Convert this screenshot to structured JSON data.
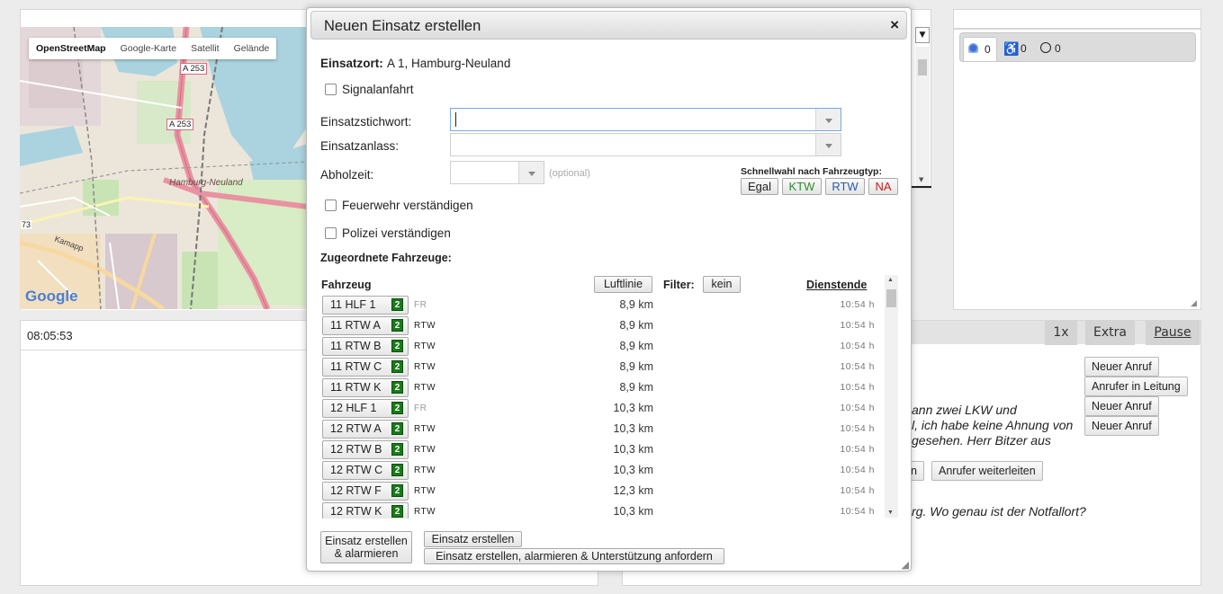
{
  "map": {
    "tabs": [
      "OpenStreetMap",
      "Google-Karte",
      "Satellit",
      "Gelände"
    ],
    "labels": {
      "a253_top": "A 253",
      "a253_mid": "A 253",
      "hamburg_neuland": "Hamburg-Neuland",
      "route73": "73",
      "street": "Kamapp",
      "logo": "Google"
    }
  },
  "clock": "08:05:53",
  "status_counts": {
    "blue_light": "0",
    "wheelchair": "0",
    "clock": "0"
  },
  "sim_controls": {
    "speed": "1x",
    "extra": "Extra",
    "pause": "Pause"
  },
  "call_buttons": [
    "Neuer Anruf",
    "Anrufer in Leitung",
    "Neuer Anruf",
    "Neuer Anruf"
  ],
  "conversation": {
    "line1": "ann zwei LKW und",
    "line2": "l, ich habe keine Ahnung von",
    "line3": "gesehen. Herr Bitzer aus",
    "btn_partial": "n",
    "btn_forward": "Anrufer weiterleiten",
    "question": "rg. Wo genau ist der Notfallort?"
  },
  "modal": {
    "title": "Neuen Einsatz erstellen",
    "close": "×",
    "einsatzort_label": "Einsatzort:",
    "einsatzort_value": "A 1, Hamburg-Neuland",
    "signalanfahrt": "Signalanfahrt",
    "stichwort_label": "Einsatzstichwort:",
    "stichwort_value": "",
    "anlass_label": "Einsatzanlass:",
    "anlass_value": "",
    "abholzeit_label": "Abholzeit:",
    "abholzeit_hint": "(optional)",
    "schnellwahl_label": "Schnellwahl nach Fahrzeugtyp:",
    "schnellwahl": [
      {
        "label": "Egal",
        "color": "#222222"
      },
      {
        "label": "KTW",
        "color": "#2e8b2e"
      },
      {
        "label": "RTW",
        "color": "#2a5bb0"
      },
      {
        "label": "NA",
        "color": "#c02020"
      }
    ],
    "feuerwehr": "Feuerwehr verständigen",
    "polizei": "Polizei verständigen",
    "zugeordnet": "Zugeordnete Fahrzeuge:",
    "col_vehicle": "Fahrzeug",
    "luftlinie": "Luftlinie",
    "filter_label": "Filter:",
    "filter_value": "kein",
    "col_end": "Dienstende",
    "vehicles": [
      {
        "name": "11 HLF 1",
        "badge": "2",
        "type": "FR",
        "dist": "8,9 km",
        "end": "10:54 h"
      },
      {
        "name": "11 RTW A",
        "badge": "2",
        "type": "RTW",
        "dist": "8,9 km",
        "end": "10:54 h"
      },
      {
        "name": "11 RTW B",
        "badge": "2",
        "type": "RTW",
        "dist": "8,9 km",
        "end": "10:54 h"
      },
      {
        "name": "11 RTW C",
        "badge": "2",
        "type": "RTW",
        "dist": "8,9 km",
        "end": "10:54 h"
      },
      {
        "name": "11 RTW K",
        "badge": "2",
        "type": "RTW",
        "dist": "8,9 km",
        "end": "10:54 h"
      },
      {
        "name": "12 HLF 1",
        "badge": "2",
        "type": "FR",
        "dist": "10,3 km",
        "end": "10:54 h"
      },
      {
        "name": "12 RTW A",
        "badge": "2",
        "type": "RTW",
        "dist": "10,3 km",
        "end": "10:54 h"
      },
      {
        "name": "12 RTW B",
        "badge": "2",
        "type": "RTW",
        "dist": "10,3 km",
        "end": "10:54 h"
      },
      {
        "name": "12 RTW C",
        "badge": "2",
        "type": "RTW",
        "dist": "10,3 km",
        "end": "10:54 h"
      },
      {
        "name": "12 RTW F",
        "badge": "2",
        "type": "RTW",
        "dist": "12,3 km",
        "end": "10:54 h"
      },
      {
        "name": "12 RTW K",
        "badge": "2",
        "type": "RTW",
        "dist": "10,3 km",
        "end": "10:54 h"
      }
    ],
    "btn_create_alarm_line1": "Einsatz erstellen",
    "btn_create_alarm_line2": "& alarmieren",
    "btn_create": "Einsatz erstellen",
    "btn_create_support": "Einsatz erstellen, alarmieren & Unterstützung anfordern"
  }
}
